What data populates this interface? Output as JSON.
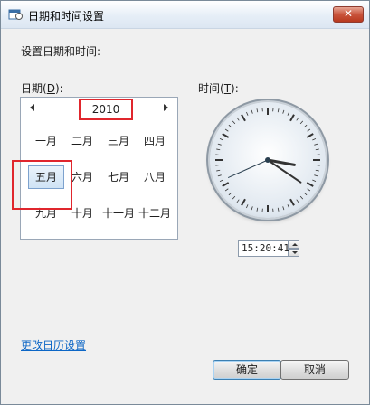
{
  "window": {
    "title": "日期和时间设置",
    "close_label": "✕"
  },
  "content": {
    "section_label": "设置日期和时间:"
  },
  "date": {
    "label": "日期(",
    "mnemonic": "D",
    "label_end": "):"
  },
  "time": {
    "label": "时间(",
    "mnemonic": "T",
    "label_end": "):",
    "value": "15:20:41"
  },
  "calendar": {
    "year": "2010",
    "months": [
      "一月",
      "二月",
      "三月",
      "四月",
      "五月",
      "六月",
      "七月",
      "八月",
      "九月",
      "十月",
      "十一月",
      "十二月"
    ],
    "selected_month": "五月"
  },
  "clock": {
    "hours": 15,
    "minutes": 20,
    "seconds": 41
  },
  "footer": {
    "link_text": "更改日历设置",
    "ok_label": "确定",
    "cancel_label": "取消"
  },
  "colors": {
    "highlight": "#e0262d",
    "link": "#0c66c6"
  },
  "icons": {
    "title": "calendar-clock-icon",
    "close": "close-icon"
  }
}
